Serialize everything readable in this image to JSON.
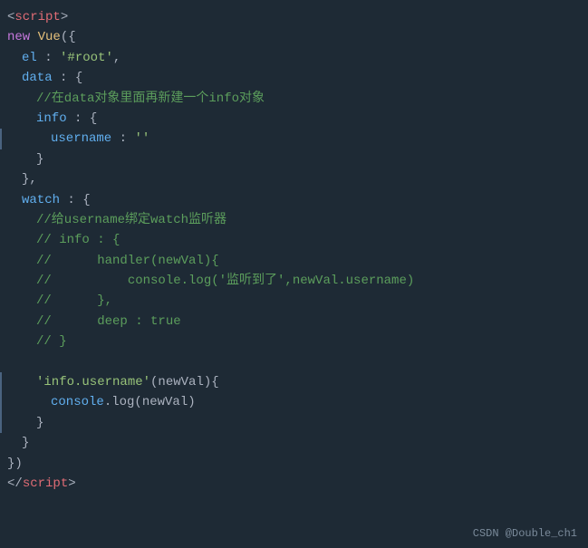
{
  "code": {
    "lines": [
      {
        "id": "l1",
        "indent": 0,
        "tokens": [
          {
            "text": "<",
            "cls": "c-bracket"
          },
          {
            "text": "script",
            "cls": "c-red"
          },
          {
            "text": ">",
            "cls": "c-bracket"
          }
        ]
      },
      {
        "id": "l2",
        "indent": 0,
        "tokens": [
          {
            "text": "new ",
            "cls": "c-keyword"
          },
          {
            "text": "Vue",
            "cls": "c-value"
          },
          {
            "text": "({",
            "cls": "c-bracket"
          }
        ]
      },
      {
        "id": "l3",
        "indent": 1,
        "tokens": [
          {
            "text": "el",
            "cls": "c-property"
          },
          {
            "text": " : ",
            "cls": "c-white"
          },
          {
            "text": "'#root'",
            "cls": "c-green"
          },
          {
            "text": ",",
            "cls": "c-white"
          }
        ]
      },
      {
        "id": "l4",
        "indent": 1,
        "tokens": [
          {
            "text": "data",
            "cls": "c-property"
          },
          {
            "text": " : {",
            "cls": "c-white"
          }
        ]
      },
      {
        "id": "l5",
        "indent": 2,
        "tokens": [
          {
            "text": "//在data对象里面再新建一个info对象",
            "cls": "c-comment"
          }
        ]
      },
      {
        "id": "l6",
        "indent": 2,
        "tokens": [
          {
            "text": "info",
            "cls": "c-property"
          },
          {
            "text": " : {",
            "cls": "c-white"
          }
        ]
      },
      {
        "id": "l7",
        "indent": 3,
        "border": true,
        "tokens": [
          {
            "text": "username",
            "cls": "c-property"
          },
          {
            "text": " : ",
            "cls": "c-white"
          },
          {
            "text": "''",
            "cls": "c-green"
          }
        ]
      },
      {
        "id": "l8",
        "indent": 2,
        "tokens": [
          {
            "text": "}",
            "cls": "c-white"
          }
        ]
      },
      {
        "id": "l9",
        "indent": 1,
        "tokens": [
          {
            "text": "},",
            "cls": "c-white"
          }
        ]
      },
      {
        "id": "l10",
        "indent": 1,
        "tokens": [
          {
            "text": "watch",
            "cls": "c-property"
          },
          {
            "text": " : {",
            "cls": "c-white"
          }
        ]
      },
      {
        "id": "l11",
        "indent": 2,
        "tokens": [
          {
            "text": "//给username绑定watch监听器",
            "cls": "c-comment"
          }
        ]
      },
      {
        "id": "l12",
        "indent": 2,
        "tokens": [
          {
            "text": "// info : {",
            "cls": "c-comment"
          }
        ]
      },
      {
        "id": "l13",
        "indent": 2,
        "tokens": [
          {
            "text": "//      handler(newVal){",
            "cls": "c-comment"
          }
        ]
      },
      {
        "id": "l14",
        "indent": 2,
        "tokens": [
          {
            "text": "//          console.log('监听到了',newVal.username)",
            "cls": "c-comment"
          }
        ]
      },
      {
        "id": "l15",
        "indent": 2,
        "tokens": [
          {
            "text": "//      },",
            "cls": "c-comment"
          }
        ]
      },
      {
        "id": "l16",
        "indent": 2,
        "tokens": [
          {
            "text": "//      deep : true",
            "cls": "c-comment"
          }
        ]
      },
      {
        "id": "l17",
        "indent": 2,
        "tokens": [
          {
            "text": "// }",
            "cls": "c-comment"
          }
        ]
      },
      {
        "id": "l18",
        "indent": 0,
        "tokens": []
      },
      {
        "id": "l19",
        "indent": 2,
        "border": true,
        "tokens": [
          {
            "text": "'info.username'",
            "cls": "c-green"
          },
          {
            "text": "(newVal){",
            "cls": "c-white"
          }
        ]
      },
      {
        "id": "l20",
        "indent": 3,
        "border": true,
        "tokens": [
          {
            "text": "console",
            "cls": "c-blue"
          },
          {
            "text": ".log(",
            "cls": "c-white"
          },
          {
            "text": "newVal",
            "cls": "c-white"
          },
          {
            "text": ")",
            "cls": "c-white"
          }
        ]
      },
      {
        "id": "l21",
        "indent": 2,
        "border": true,
        "tokens": [
          {
            "text": "}",
            "cls": "c-white"
          }
        ]
      },
      {
        "id": "l22",
        "indent": 1,
        "tokens": [
          {
            "text": "}",
            "cls": "c-white"
          }
        ]
      },
      {
        "id": "l23",
        "indent": 0,
        "tokens": [
          {
            "text": "})",
            "cls": "c-white"
          }
        ]
      },
      {
        "id": "l24",
        "indent": 0,
        "tokens": [
          {
            "text": "</",
            "cls": "c-bracket"
          },
          {
            "text": "script",
            "cls": "c-red"
          },
          {
            "text": ">",
            "cls": "c-bracket"
          }
        ]
      }
    ],
    "footer": "CSDN @Double_ch1"
  }
}
